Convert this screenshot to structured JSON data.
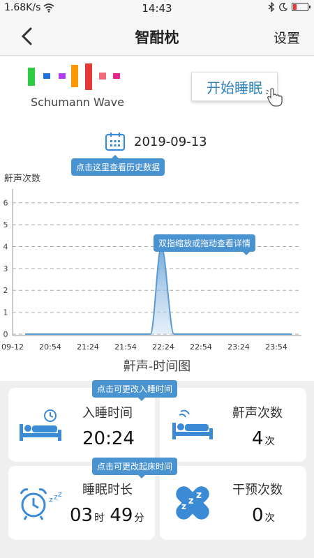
{
  "status_bar": {
    "speed": "1.68K/s",
    "time": "14:43"
  },
  "nav": {
    "title": "智酣枕",
    "settings": "设置"
  },
  "wave": {
    "label": "Schumann Wave",
    "colors": [
      "#2ecc40",
      "#1e6fe0",
      "#b23cf0",
      "#ff9800",
      "#e53935",
      "#f06a7a",
      "#e0268c"
    ]
  },
  "start_button": "开始睡眠",
  "date": "2019-09-13",
  "tips": {
    "history": "点击这里查看历史数据",
    "zoom": "双指缩放或拖动查看详情",
    "sleep_time": "点击可更改入睡时间",
    "wake_time": "点击可更改起床时间"
  },
  "chart_data": {
    "type": "area",
    "title": "鼾声-时间图",
    "ylabel": "鼾声次数",
    "xlabel": "",
    "ylim": [
      0,
      6.5
    ],
    "yticks": [
      "0",
      "1",
      "2",
      "3",
      "4",
      "5",
      "6"
    ],
    "xticks": [
      "09-12",
      "20:54",
      "21:24",
      "21:54",
      "22:24",
      "22:54",
      "23:24",
      "23:54"
    ],
    "series": [
      {
        "x": [
          "20:24",
          "22:05",
          "22:09",
          "22:14",
          "22:19",
          "22:24",
          "23:59"
        ],
        "values": [
          0,
          0,
          1.5,
          4,
          1.5,
          0,
          0
        ]
      }
    ],
    "grid": true,
    "color": "#5b9bd5"
  },
  "cards": {
    "sleep_time": {
      "label": "入睡时间",
      "value": "20:24"
    },
    "snore_count": {
      "label": "鼾声次数",
      "value": "4",
      "unit": "次"
    },
    "duration": {
      "label": "睡眠时长",
      "hours": "03",
      "hours_unit": "时",
      "minutes": "49",
      "minutes_unit": "分"
    },
    "intervention": {
      "label": "干预次数",
      "value": "0",
      "unit": "次"
    }
  }
}
